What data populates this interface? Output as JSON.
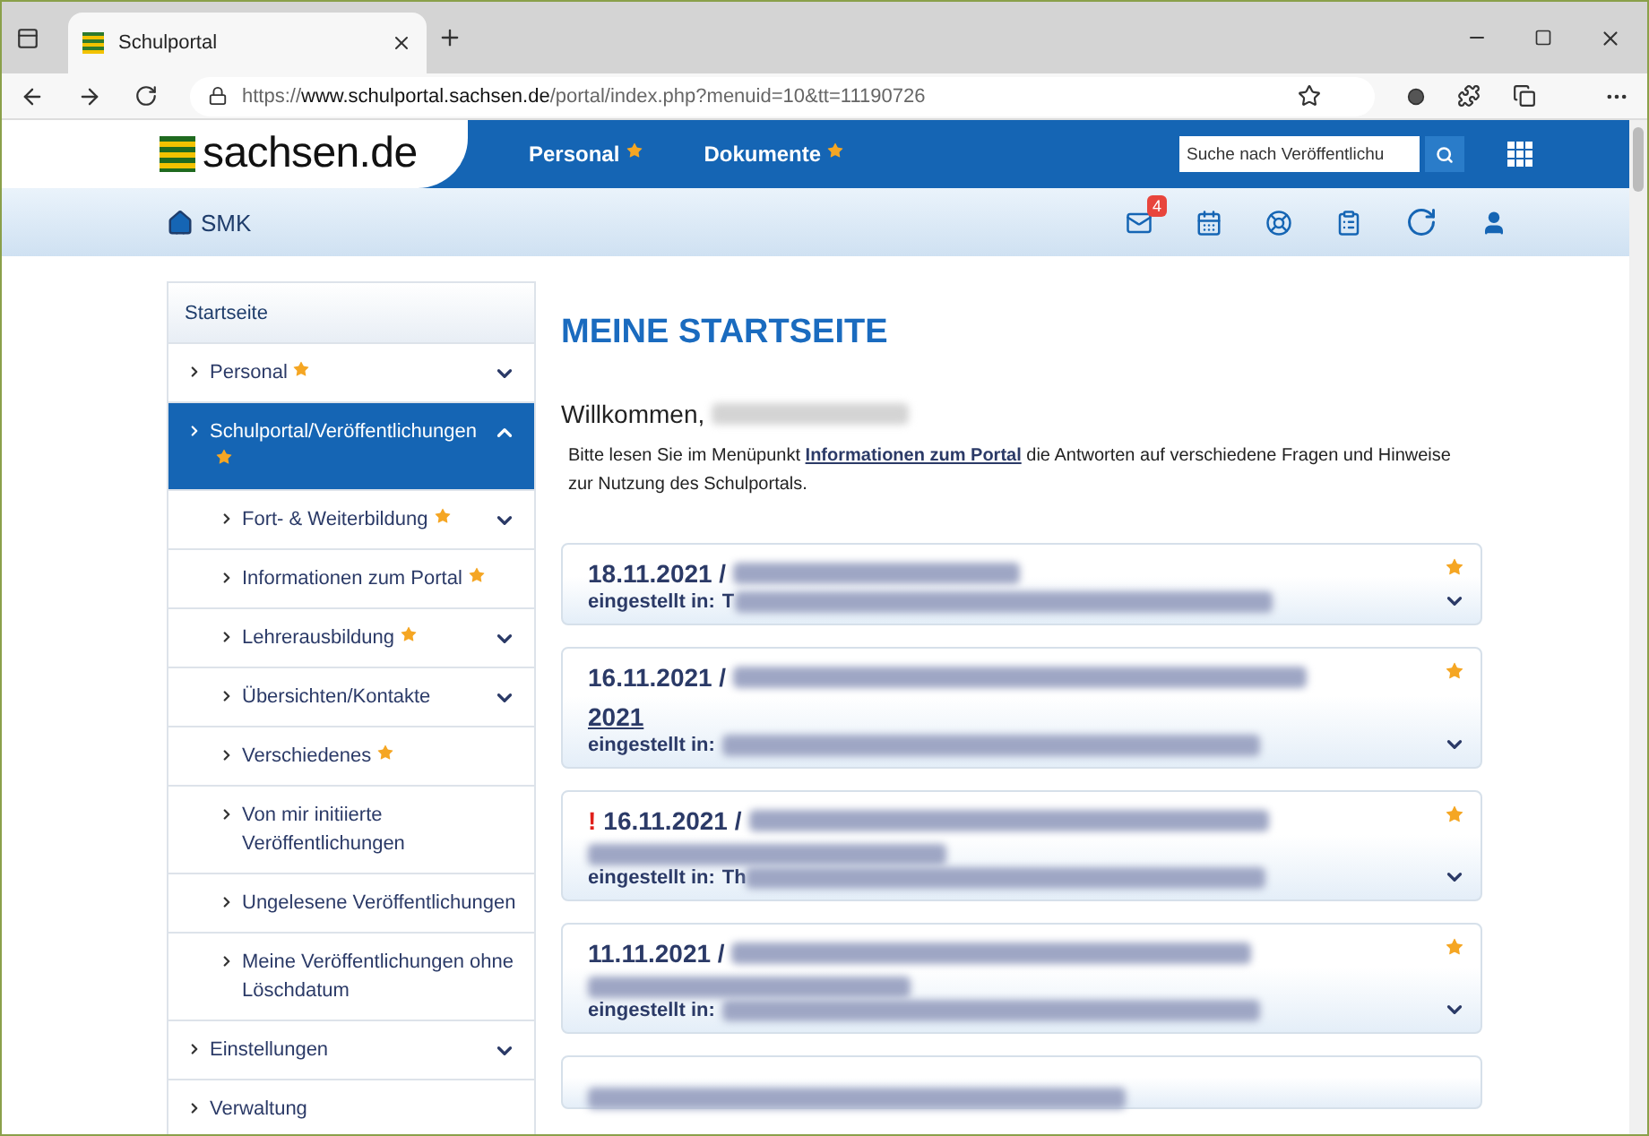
{
  "browser": {
    "tab_title": "Schulportal",
    "url_prefix": "https://",
    "url_host": "www.schulportal.sachsen.de",
    "url_path": "/portal/index.php?menuid=10&tt=11190726"
  },
  "header": {
    "logo": "sachsen.de",
    "nav": [
      {
        "label": "Personal",
        "starred": true
      },
      {
        "label": "Dokumente",
        "starred": true
      }
    ],
    "search": {
      "placeholder": "Suche nach Veröffentlichu"
    }
  },
  "subbar": {
    "org": "SMK",
    "mail_badge": "4"
  },
  "sidebar": {
    "title": "Startseite",
    "items": [
      {
        "label": "Personal",
        "starred": true,
        "expandable": true,
        "expanded": false,
        "selected": false
      },
      {
        "label": "Schulportal/Veröffentlichungen",
        "starred": true,
        "expandable": true,
        "expanded": true,
        "selected": true,
        "children": [
          {
            "label": "Fort- & Weiterbildung",
            "starred": true,
            "expandable": true,
            "expanded": false,
            "selected": false
          },
          {
            "label": "Informationen zum Portal",
            "starred": true,
            "expandable": false,
            "expanded": false,
            "selected": false
          },
          {
            "label": "Lehrerausbildung",
            "starred": true,
            "expandable": true,
            "expanded": false,
            "selected": false
          },
          {
            "label": "Übersichten/Kontakte",
            "starred": false,
            "expandable": true,
            "expanded": false,
            "selected": false
          },
          {
            "label": "Verschiedenes",
            "starred": true,
            "expandable": false,
            "expanded": false,
            "selected": false
          },
          {
            "label": "Von mir initiierte Veröffentlichungen",
            "starred": false,
            "expandable": false,
            "expanded": false,
            "selected": false
          },
          {
            "label": "Ungelesene Veröffentlichungen",
            "starred": false,
            "expandable": false,
            "expanded": false,
            "selected": false
          },
          {
            "label": "Meine Veröffentlichungen ohne Löschdatum",
            "starred": false,
            "expandable": false,
            "expanded": false,
            "selected": false
          }
        ]
      },
      {
        "label": "Einstellungen",
        "starred": false,
        "expandable": true,
        "expanded": false,
        "selected": false
      },
      {
        "label": "Verwaltung",
        "starred": false,
        "expandable": false,
        "expanded": false,
        "selected": false
      }
    ]
  },
  "main": {
    "title": "MEINE STARTSEITE",
    "welcome": "Willkommen,",
    "intro": "Bitte lesen Sie im Menüpunkt **Informationen zum Portal** die Antworten auf verschiedene Fragen und Hinweise zur Nutzung des Schulportals.",
    "cards": [
      {
        "date": "18.11.2021 /",
        "posted_label": "eingestellt in:",
        "posted_visible": "T",
        "starred": true
      },
      {
        "date": "16.11.2021 /",
        "title_tail": "2021",
        "posted_label": "eingestellt in:",
        "starred": true
      },
      {
        "flag": "!",
        "date": "16.11.2021 /",
        "posted_label": "eingestellt in:",
        "posted_visible": "Th",
        "starred": true
      },
      {
        "date": "11.11.2021 /",
        "posted_label": "eingestellt in:",
        "starred": true
      }
    ]
  }
}
